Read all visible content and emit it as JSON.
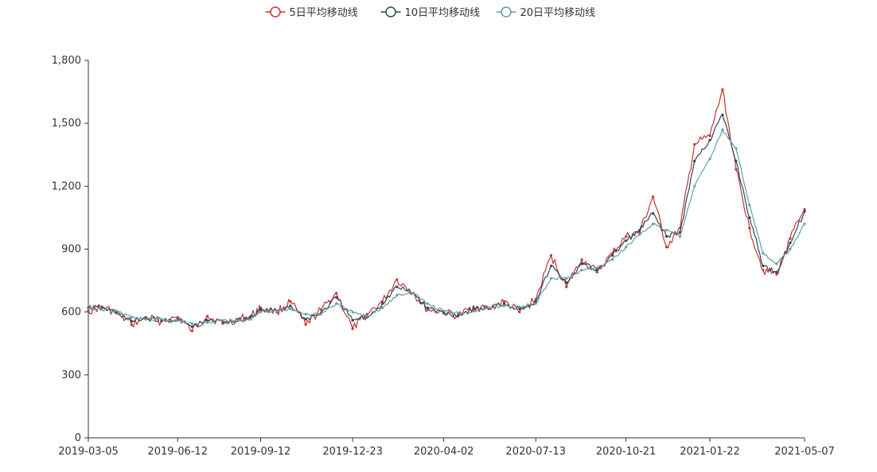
{
  "chart_data": {
    "type": "line",
    "x_range": [
      "2019-03-05",
      "2021-05-07"
    ],
    "xticks": [
      "2019-03-05",
      "2019-06-12",
      "2019-09-12",
      "2019-12-23",
      "2020-04-02",
      "2020-07-13",
      "2020-10-21",
      "2021-01-22",
      "2021-05-07"
    ],
    "yticks": [
      0,
      300,
      600,
      900,
      1200,
      1500,
      1800
    ],
    "ytick_labels": [
      "0",
      "300",
      "600",
      "900",
      "1,200",
      "1,500",
      "1,800"
    ],
    "ylim": [
      0,
      1800
    ],
    "legend_position": "top-center",
    "series": [
      {
        "name": "5日平均移动线",
        "color": "#c23531",
        "x": [
          "2019-03-05",
          "2019-03-20",
          "2019-04-05",
          "2019-04-22",
          "2019-05-08",
          "2019-05-25",
          "2019-06-12",
          "2019-06-28",
          "2019-07-15",
          "2019-08-01",
          "2019-08-18",
          "2019-09-01",
          "2019-09-12",
          "2019-09-30",
          "2019-10-15",
          "2019-11-01",
          "2019-11-18",
          "2019-12-05",
          "2019-12-23",
          "2020-01-08",
          "2020-01-25",
          "2020-02-10",
          "2020-02-28",
          "2020-03-15",
          "2020-04-02",
          "2020-04-18",
          "2020-05-05",
          "2020-05-22",
          "2020-06-08",
          "2020-06-25",
          "2020-07-13",
          "2020-07-30",
          "2020-08-16",
          "2020-09-02",
          "2020-09-19",
          "2020-10-06",
          "2020-10-21",
          "2020-11-05",
          "2020-11-20",
          "2020-12-05",
          "2020-12-20",
          "2021-01-05",
          "2021-01-22",
          "2021-02-05",
          "2021-02-20",
          "2021-03-07",
          "2021-03-22",
          "2021-04-06",
          "2021-04-21",
          "2021-05-07"
        ],
        "values": [
          605,
          625,
          595,
          540,
          575,
          555,
          575,
          510,
          580,
          545,
          565,
          580,
          620,
          600,
          650,
          540,
          610,
          690,
          520,
          590,
          650,
          755,
          690,
          610,
          600,
          580,
          625,
          615,
          650,
          600,
          660,
          870,
          720,
          850,
          790,
          880,
          960,
          980,
          1150,
          910,
          1000,
          1400,
          1440,
          1660,
          1280,
          1000,
          800,
          780,
          950,
          1090
        ]
      },
      {
        "name": "10日平均移动线",
        "color": "#2f4554",
        "x": [
          "2019-03-05",
          "2019-03-20",
          "2019-04-05",
          "2019-04-22",
          "2019-05-08",
          "2019-05-25",
          "2019-06-12",
          "2019-06-28",
          "2019-07-15",
          "2019-08-01",
          "2019-08-18",
          "2019-09-01",
          "2019-09-12",
          "2019-09-30",
          "2019-10-15",
          "2019-11-01",
          "2019-11-18",
          "2019-12-05",
          "2019-12-23",
          "2020-01-08",
          "2020-01-25",
          "2020-02-10",
          "2020-02-28",
          "2020-03-15",
          "2020-04-02",
          "2020-04-18",
          "2020-05-05",
          "2020-05-22",
          "2020-06-08",
          "2020-06-25",
          "2020-07-13",
          "2020-07-30",
          "2020-08-16",
          "2020-09-02",
          "2020-09-19",
          "2020-10-06",
          "2020-10-21",
          "2020-11-05",
          "2020-11-20",
          "2020-12-05",
          "2020-12-20",
          "2021-01-05",
          "2021-01-22",
          "2021-02-05",
          "2021-02-20",
          "2021-03-07",
          "2021-03-22",
          "2021-04-06",
          "2021-04-21",
          "2021-05-07"
        ],
        "values": [
          620,
          618,
          600,
          555,
          570,
          560,
          565,
          530,
          560,
          555,
          560,
          575,
          610,
          605,
          630,
          565,
          595,
          670,
          560,
          575,
          640,
          720,
          690,
          620,
          595,
          585,
          615,
          620,
          640,
          615,
          650,
          820,
          740,
          830,
          800,
          870,
          940,
          990,
          1070,
          960,
          980,
          1320,
          1420,
          1540,
          1320,
          1050,
          820,
          790,
          930,
          1080
        ]
      },
      {
        "name": "20日平均移动线",
        "color": "#61a0a8",
        "x": [
          "2019-03-05",
          "2019-03-20",
          "2019-04-05",
          "2019-04-22",
          "2019-05-08",
          "2019-05-25",
          "2019-06-12",
          "2019-06-28",
          "2019-07-15",
          "2019-08-01",
          "2019-08-18",
          "2019-09-01",
          "2019-09-12",
          "2019-09-30",
          "2019-10-15",
          "2019-11-01",
          "2019-11-18",
          "2019-12-05",
          "2019-12-23",
          "2020-01-08",
          "2020-01-25",
          "2020-02-10",
          "2020-02-28",
          "2020-03-15",
          "2020-04-02",
          "2020-04-18",
          "2020-05-05",
          "2020-05-22",
          "2020-06-08",
          "2020-06-25",
          "2020-07-13",
          "2020-07-30",
          "2020-08-16",
          "2020-09-02",
          "2020-09-19",
          "2020-10-06",
          "2020-10-21",
          "2020-11-05",
          "2020-11-20",
          "2020-12-05",
          "2020-12-20",
          "2021-01-05",
          "2021-01-22",
          "2021-02-05",
          "2021-02-20",
          "2021-03-07",
          "2021-03-22",
          "2021-04-06",
          "2021-04-21",
          "2021-05-07"
        ],
        "values": [
          615,
          612,
          605,
          575,
          565,
          565,
          560,
          545,
          550,
          560,
          560,
          565,
          600,
          605,
          615,
          590,
          590,
          640,
          600,
          580,
          620,
          680,
          690,
          640,
          605,
          595,
          605,
          620,
          630,
          625,
          640,
          760,
          760,
          800,
          810,
          850,
          910,
          970,
          1020,
          990,
          960,
          1200,
          1330,
          1470,
          1380,
          1110,
          880,
          830,
          900,
          1020
        ]
      }
    ]
  }
}
